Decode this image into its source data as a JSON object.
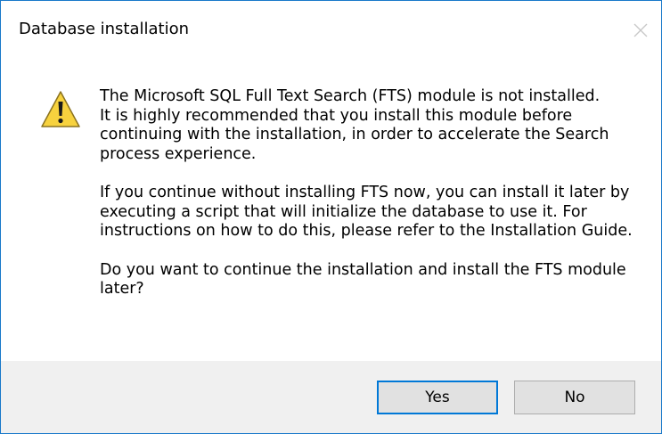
{
  "window": {
    "title": "Database installation",
    "close_icon": "close-icon"
  },
  "dialog": {
    "icon": "warning-icon",
    "paragraphs": [
      "The Microsoft SQL Full Text Search (FTS) module is not installed.\nIt is highly recommended that you install this module before continuing with the installation, in order to accelerate the Search process experience.",
      "If you continue without installing FTS now, you can install it later by executing a script that will initialize the database to use it. For instructions on how to do this, please refer to the Installation Guide.",
      "Do you want to continue the installation and install the FTS module later?"
    ]
  },
  "buttons": {
    "yes_label": "Yes",
    "no_label": "No"
  },
  "colors": {
    "window_border": "#1979ca",
    "footer_background": "#f0f0f0",
    "button_background": "#e1e1e1",
    "default_button_border": "#0078d7",
    "warning_fill": "#f7d23e"
  }
}
